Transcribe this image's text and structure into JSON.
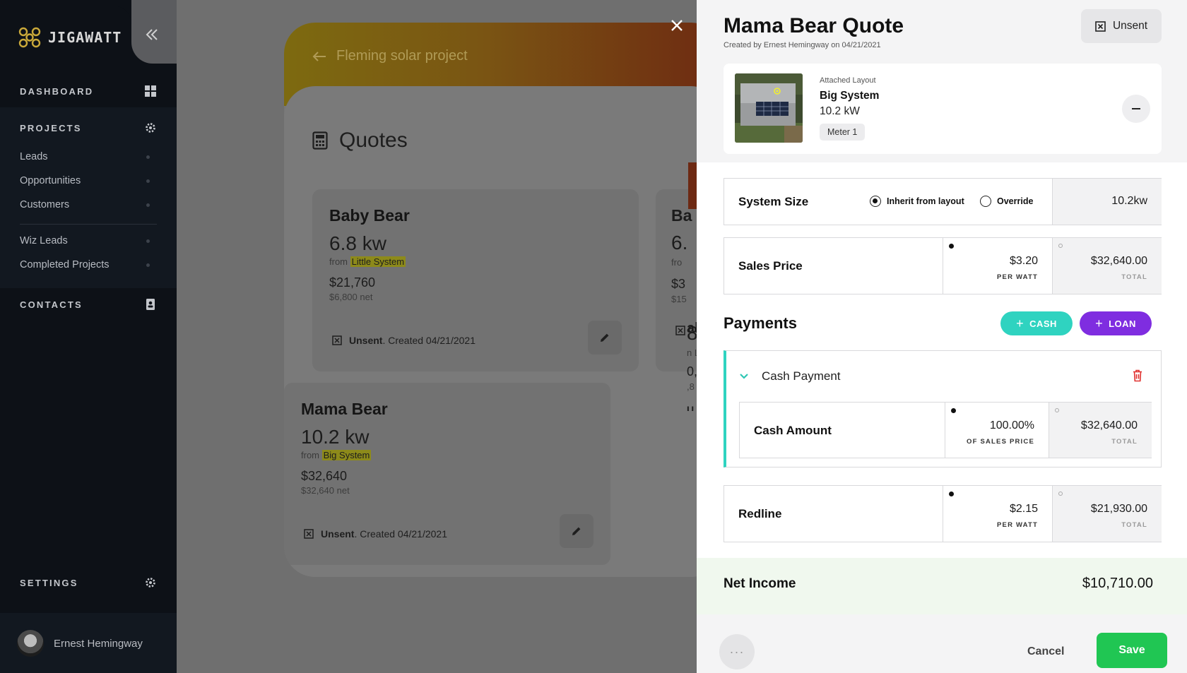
{
  "sidebar": {
    "brand": "JIGAWATT",
    "sections": {
      "dashboard": "DASHBOARD",
      "projects": "PROJECTS",
      "contacts": "CONTACTS",
      "settings": "SETTINGS"
    },
    "project_items": [
      "Leads",
      "Opportunities",
      "Customers"
    ],
    "extra_items": [
      "Wiz Leads",
      "Completed Projects"
    ],
    "user_name": "Ernest Hemingway"
  },
  "project": {
    "back_label": "Fleming solar project",
    "quotes_title": "Quotes",
    "quotes": [
      {
        "name": "Baby Bear",
        "kw": "6.8 kw",
        "from_prefix": "from",
        "from_system": "Little System",
        "price": "$21,760",
        "net": "$6,800 net",
        "status": "Unsent",
        "created": ". Created 04/21/2021"
      },
      {
        "name": "Mama Bear",
        "kw": "10.2 kw",
        "from_prefix": "from",
        "from_system": "Big System",
        "price": "$32,640",
        "net": "$32,640 net",
        "status": "Unsent",
        "created": ". Created 04/21/2021"
      }
    ],
    "peek": {
      "name": "Ba",
      "kw": "6.",
      "from": "fro",
      "price": "$3",
      "net": "$15",
      "name2": "al",
      "kw2": "8",
      "from2": "n L",
      "price2": "0,",
      "net2": ",8",
      "status2": "U"
    }
  },
  "panel": {
    "title": "Mama Bear Quote",
    "subtitle": "Created by Ernest Hemingway on 04/21/2021",
    "status_button": "Unsent",
    "layout": {
      "attached_label": "Attached Layout",
      "name": "Big System",
      "kw": "10.2 kW",
      "meter": "Meter 1"
    },
    "system_size": {
      "label": "System Size",
      "inherit_label": "Inherit from layout",
      "override_label": "Override",
      "selected": "inherit",
      "value": "10.2kw"
    },
    "sales_price": {
      "label": "Sales Price",
      "per_watt": "$3.20",
      "per_watt_unit": "PER WATT",
      "total": "$32,640.00",
      "total_unit": "TOTAL"
    },
    "payments": {
      "title": "Payments",
      "cash_button": "CASH",
      "loan_button": "LOAN",
      "cash_payment": {
        "title": "Cash Payment",
        "amount_label": "Cash Amount",
        "percent": "100.00%",
        "percent_unit": "OF SALES PRICE",
        "total": "$32,640.00",
        "total_unit": "TOTAL"
      }
    },
    "redline": {
      "label": "Redline",
      "per_watt": "$2.15",
      "per_watt_unit": "PER WATT",
      "total": "$21,930.00",
      "total_unit": "TOTAL"
    },
    "net_income": {
      "label": "Net Income",
      "value": "$10,710.00"
    },
    "footer": {
      "more": "···",
      "cancel": "Cancel",
      "save": "Save"
    }
  },
  "colors": {
    "teal": "#2fd3c0",
    "purple": "#7f2de0",
    "save_green": "#20c653",
    "trash_red": "#e0312f",
    "highlight_yellow": "#f2ee2e"
  }
}
